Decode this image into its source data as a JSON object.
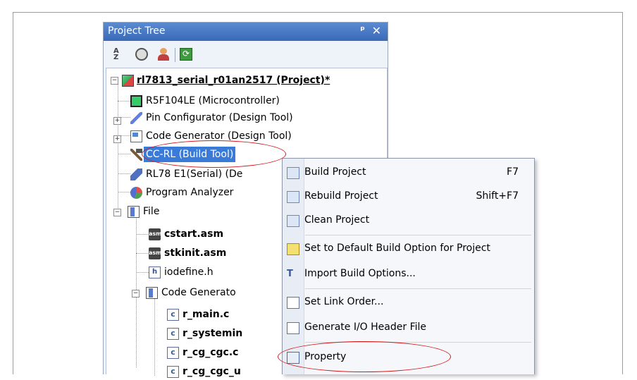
{
  "panel": {
    "title": "Project Tree",
    "pin_glyph": "ᵖ",
    "close_glyph": "✕",
    "toolbar": {
      "sort_icon": "sort-az-icon",
      "clock_icon": "clock-icon",
      "user_icon": "user-icon",
      "refresh_icon": "refresh-icon",
      "refresh_glyph": "⟳"
    }
  },
  "tree": {
    "project": "rl7813_serial_r01an2517 (Project)*",
    "microcontroller": "R5F104LE (Microcontroller)",
    "pin_configurator": "Pin Configurator (Design Tool)",
    "code_generator_tool": "Code Generator (Design Tool)",
    "build_tool": "CC-RL (Build Tool)",
    "debug_tool": "RL78 E1(Serial) (De",
    "program_analyzer": "Program Analyzer",
    "file_folder": "File",
    "cstart": "cstart.asm",
    "stkinit": "stkinit.asm",
    "iodefine": "iodefine.h",
    "code_generator_folder": "Code Generato",
    "r_main": "r_main.c",
    "r_systeminit": "r_systemin",
    "r_cg_cgc": "r_cg_cgc.c",
    "r_cg_cgc_user": "r_cg_cgc_u",
    "asm_badge": "asm",
    "h_badge": "h",
    "c_badge": "c"
  },
  "context_menu": {
    "items": [
      {
        "label": "Build Project",
        "shortcut": "F7"
      },
      {
        "label": "Rebuild Project",
        "shortcut": "Shift+F7"
      },
      {
        "label": "Clean Project",
        "shortcut": ""
      },
      {
        "label": "Set to Default Build Option for Project",
        "shortcut": ""
      },
      {
        "label": "Import Build Options...",
        "shortcut": ""
      },
      {
        "label": "Set Link Order...",
        "shortcut": ""
      },
      {
        "label": "Generate I/O Header File",
        "shortcut": ""
      },
      {
        "label": "Property",
        "shortcut": ""
      }
    ]
  },
  "colors": {
    "highlight_oval": "#d21a1a",
    "selection": "#3a7ad8",
    "title_bar": "#3a6ab8"
  }
}
